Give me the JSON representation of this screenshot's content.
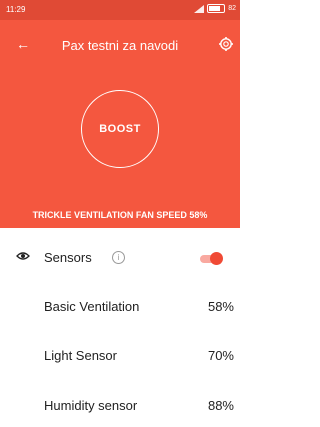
{
  "status_bar": {
    "time": "11:29",
    "battery": "82"
  },
  "header": {
    "title": "Pax testni za navodi"
  },
  "boost": {
    "label": "BOOST"
  },
  "fan_speed": {
    "text": "TRICKLE VENTILATION FAN SPEED 58%"
  },
  "sensors": {
    "label": "Sensors",
    "info_glyph": "i",
    "enabled": true
  },
  "items": [
    {
      "label": "Basic Ventilation",
      "value": "58%"
    },
    {
      "label": "Light Sensor",
      "value": "70%"
    },
    {
      "label": "Humidity sensor",
      "value": "88%"
    }
  ],
  "colors": {
    "accent": "#f4573f",
    "status_bar": "#e04a35",
    "toggle_on": "#f04a35"
  }
}
